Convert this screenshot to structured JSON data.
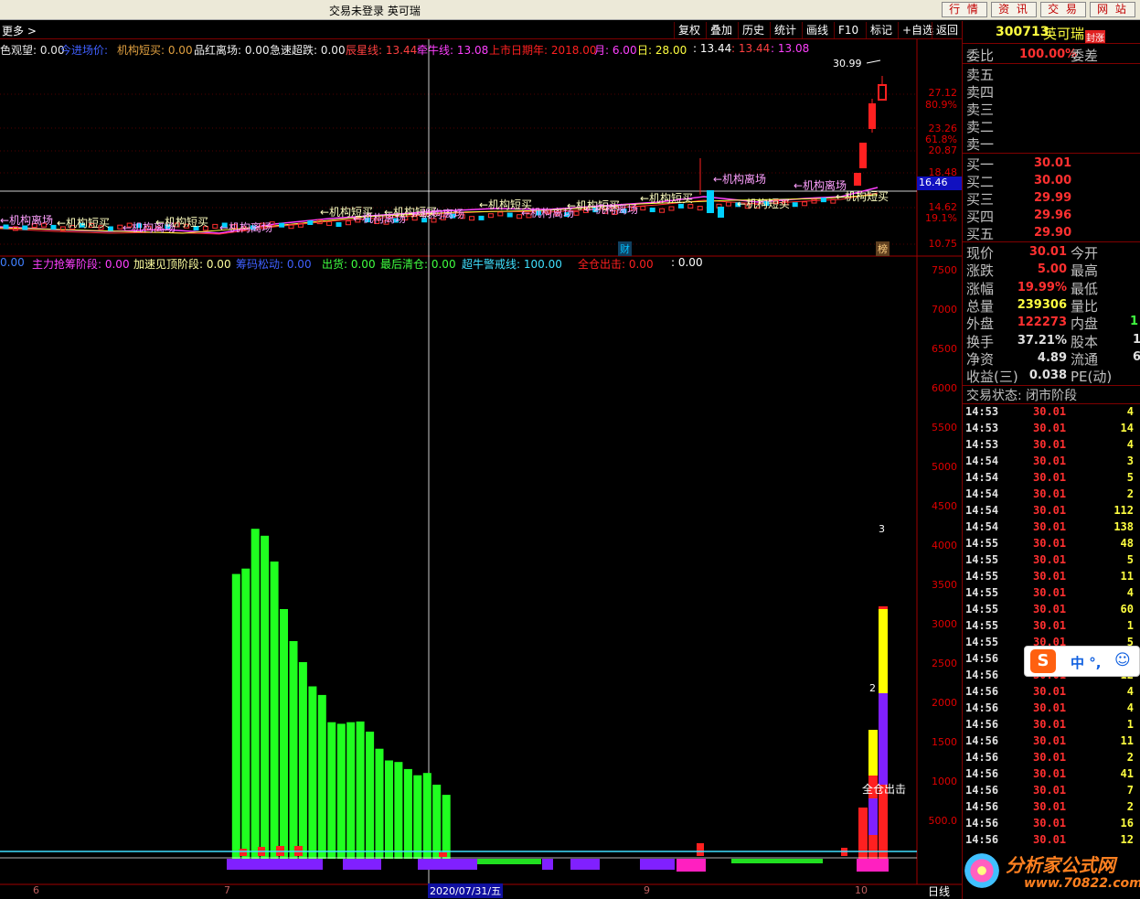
{
  "window": {
    "title": "交易未登录  英可瑞"
  },
  "top_buttons": [
    "行 情",
    "资 讯",
    "交 易",
    "网 站"
  ],
  "toolbar": {
    "more": "更多 >",
    "items": [
      "复权",
      "叠加",
      "历史",
      "统计",
      "画线",
      "F10",
      "标记",
      "+自选",
      "返回"
    ]
  },
  "main_indicator_line": [
    {
      "t": "色观望: 0.00",
      "c": "#e8e8e8"
    },
    {
      "t": "今进场价: ",
      "c": "#4060ff"
    },
    {
      "t": "机构短买: 0.00",
      "c": "#e0a040"
    },
    {
      "t": "品红离场: 0.00",
      "c": "#f0f0f0"
    },
    {
      "t": "急速超跌: 0.00",
      "c": "#f0f0f0"
    },
    {
      "t": "辰星线: 13.44",
      "c": "#ff4040"
    },
    {
      "t": "牵牛线: 13.08",
      "c": "#ff40ff"
    },
    {
      "t": "上市日期年: 2018.00",
      "c": "#ff2020"
    },
    {
      "t": "月: 6.00",
      "c": "#ff40ff"
    },
    {
      "t": "日: 28.00",
      "c": "#ffff40"
    },
    {
      "t": ": 13.44",
      "c": "#ffffff"
    },
    {
      "t": ": 13.44",
      "c": "#ff4040"
    },
    {
      "t": ": 13.08",
      "c": "#ff40ff"
    }
  ],
  "sub_indicator_line": [
    {
      "t": "0.00",
      "c": "#4080ff"
    },
    {
      "t": "主力抢筹阶段: 0.00",
      "c": "#ff40ff"
    },
    {
      "t": "加速见顶阶段: 0.00",
      "c": "#ffffa0"
    },
    {
      "t": "筹码松动: 0.00",
      "c": "#4060ff"
    },
    {
      "t": "出货: 0.00",
      "c": "#40ff40"
    },
    {
      "t": "最后清仓: 0.00",
      "c": "#40ff40"
    },
    {
      "t": "超牛警戒线: 100.00",
      "c": "#40e0ff"
    },
    {
      "t": "全仓出击: 0.00",
      "c": "#ff2020"
    },
    {
      "t": ": 0.00",
      "c": "#ffffff"
    }
  ],
  "price_axis": [
    "27.12",
    "80.9%",
    "23.26",
    "61.8%",
    "20.87",
    "18.48",
    "16.46",
    "14.62",
    "19.1%",
    "10.75"
  ],
  "price_marker": "16.46",
  "high_label": "30.99",
  "chart_annotations": [
    "机构离场",
    "机构短买",
    "机构离场",
    "机构短买",
    "机构离场",
    "机构短买",
    "机构离场",
    "机构短买",
    "机构离场",
    "机构短买",
    "机构离场",
    "机构短买",
    "机构离场",
    "机构短买"
  ],
  "badges": [
    "财",
    "榜"
  ],
  "volume_axis": [
    "7500",
    "7000",
    "6500",
    "6000",
    "5500",
    "5000",
    "4500",
    "4000",
    "3500",
    "3000",
    "2500",
    "2000",
    "1500",
    "1000",
    "500.0"
  ],
  "volume_labels": {
    "three": "3",
    "two": "2",
    "full": "全仓出击"
  },
  "date_axis": [
    "6",
    "7",
    "2020/07/31/五",
    "9",
    "10"
  ],
  "period": "日线",
  "chart_data": {
    "type": "bar",
    "series": [
      {
        "values": [
          0,
          0,
          0,
          0,
          0,
          0,
          0,
          0,
          0,
          0,
          0,
          0,
          0,
          0,
          0,
          0,
          0,
          0,
          0,
          0,
          0,
          0,
          0,
          0,
          3650,
          3720,
          4230,
          4140,
          3810,
          3200,
          2790,
          2520,
          2210,
          2100,
          1750,
          1730,
          1750,
          1760,
          1630,
          1410,
          1260,
          1240,
          1150,
          1070,
          1100,
          950,
          820,
          0,
          0,
          0,
          0,
          0,
          0,
          0,
          0,
          0,
          0,
          0,
          0,
          0,
          0,
          0,
          0,
          0,
          0,
          0,
          0,
          0,
          0,
          0,
          0,
          0,
          0,
          0,
          0,
          0,
          0,
          0,
          0,
          0,
          0,
          0,
          0,
          0,
          0,
          0,
          0,
          0,
          0,
          0,
          0,
          0,
          0
        ]
      }
    ]
  },
  "stock": {
    "code": "300713",
    "name": "英可瑞",
    "tag": "封涨"
  },
  "quote": {
    "weibi_label": "委比",
    "weibi": "100.00%",
    "weicha_label": "委差",
    "asks": [
      "卖五",
      "卖四",
      "卖三",
      "卖二",
      "卖一"
    ],
    "bids": [
      {
        "l": "买一",
        "p": "30.01"
      },
      {
        "l": "买二",
        "p": "30.00"
      },
      {
        "l": "买三",
        "p": "29.99"
      },
      {
        "l": "买四",
        "p": "29.96"
      },
      {
        "l": "买五",
        "p": "29.90"
      }
    ],
    "stats": [
      {
        "l": "现价",
        "v": "30.01",
        "l2": "今开",
        "c": "#ff3030"
      },
      {
        "l": "涨跌",
        "v": "5.00",
        "l2": "最高",
        "c": "#ff3030"
      },
      {
        "l": "涨幅",
        "v": "19.99%",
        "l2": "最低",
        "c": "#ff3030"
      },
      {
        "l": "总量",
        "v": "239306",
        "l2": "量比",
        "c": "#ffff40"
      },
      {
        "l": "外盘",
        "v": "122273",
        "l2": "内盘",
        "c": "#ff3030"
      },
      {
        "l": "换手",
        "v": "37.21%",
        "l2": "股本",
        "c": "#e0e0e0"
      },
      {
        "l": "净资",
        "v": "4.89",
        "l2": "流通",
        "c": "#e0e0e0"
      },
      {
        "l": "收益(三)",
        "v": "0.038",
        "l2": "PE(动)",
        "c": "#e0e0e0"
      }
    ],
    "inner_partial": "1",
    "guben_partial": "1",
    "liutong_partial": "6",
    "status": "交易状态: 闭市阶段"
  },
  "ticks": [
    {
      "t": "14:53",
      "p": "30.01",
      "v": "4"
    },
    {
      "t": "14:53",
      "p": "30.01",
      "v": "14"
    },
    {
      "t": "14:53",
      "p": "30.01",
      "v": "4"
    },
    {
      "t": "14:54",
      "p": "30.01",
      "v": "3"
    },
    {
      "t": "14:54",
      "p": "30.01",
      "v": "5"
    },
    {
      "t": "14:54",
      "p": "30.01",
      "v": "2"
    },
    {
      "t": "14:54",
      "p": "30.01",
      "v": "112"
    },
    {
      "t": "14:54",
      "p": "30.01",
      "v": "138"
    },
    {
      "t": "14:55",
      "p": "30.01",
      "v": "48"
    },
    {
      "t": "14:55",
      "p": "30.01",
      "v": "5"
    },
    {
      "t": "14:55",
      "p": "30.01",
      "v": "11"
    },
    {
      "t": "14:55",
      "p": "30.01",
      "v": "4"
    },
    {
      "t": "14:55",
      "p": "30.01",
      "v": "60"
    },
    {
      "t": "14:55",
      "p": "30.01",
      "v": "1"
    },
    {
      "t": "14:55",
      "p": "30.01",
      "v": "5"
    },
    {
      "t": "14:56",
      "p": "30.01",
      "v": "9"
    },
    {
      "t": "14:56",
      "p": "30.01",
      "v": "12"
    },
    {
      "t": "14:56",
      "p": "30.01",
      "v": "4"
    },
    {
      "t": "14:56",
      "p": "30.01",
      "v": "4"
    },
    {
      "t": "14:56",
      "p": "30.01",
      "v": "1"
    },
    {
      "t": "14:56",
      "p": "30.01",
      "v": "11"
    },
    {
      "t": "14:56",
      "p": "30.01",
      "v": "2"
    },
    {
      "t": "14:56",
      "p": "30.01",
      "v": "41"
    },
    {
      "t": "14:56",
      "p": "30.01",
      "v": "7"
    },
    {
      "t": "14:56",
      "p": "30.01",
      "v": "2"
    },
    {
      "t": "14:56",
      "p": "30.01",
      "v": "16"
    },
    {
      "t": "14:56",
      "p": "30.01",
      "v": "12"
    }
  ],
  "ime": {
    "label": "中 °,"
  },
  "watermark": {
    "text": "分析家公式网",
    "url": "www.70822.com"
  }
}
